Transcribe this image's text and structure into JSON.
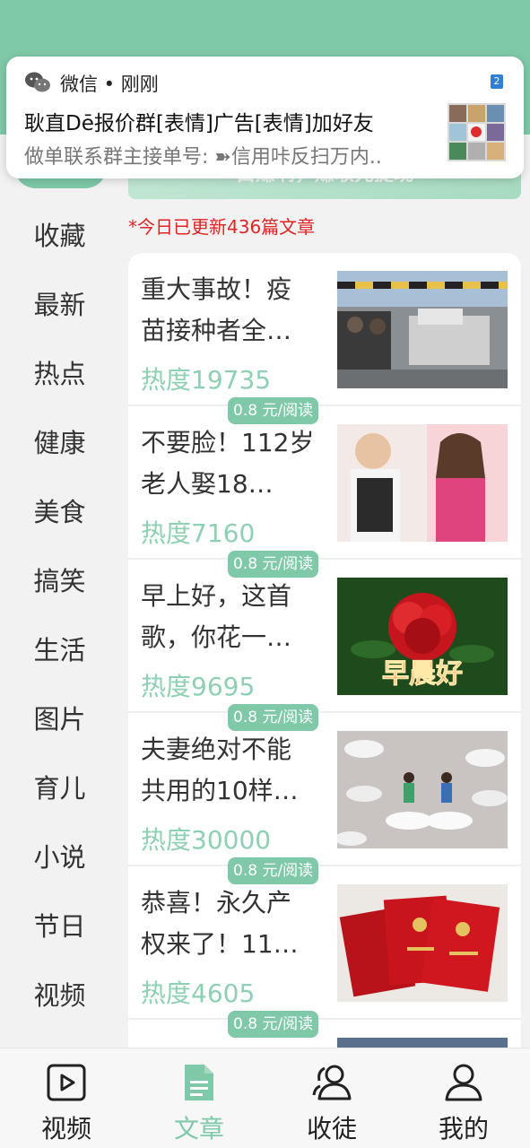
{
  "notification": {
    "app": "微信 • 刚刚",
    "badge": "2",
    "title": "耿直Dē报价群[表情]广告[表情]加好友",
    "body": "做单联系群主接单号: ➽信用咔反扫万内.."
  },
  "banner": {
    "text": "白赚啊，赚取先提现"
  },
  "update_notice": "*今日已更新436篇文章",
  "sidebar": {
    "items": [
      "收藏",
      "最新",
      "热点",
      "健康",
      "美食",
      "搞笑",
      "生活",
      "图片",
      "育儿",
      "小说",
      "节日",
      "视频"
    ]
  },
  "articles": [
    {
      "title": "重大事故！疫苗接种者全…",
      "heat": "热度19735",
      "price": "",
      "thumb": "accident-scene-photo"
    },
    {
      "title": "不要脸！112岁老人娶18…",
      "heat": "热度7160",
      "price": "0.8 元/阅读",
      "thumb": "elderly-couple-photo"
    },
    {
      "title": "早上好，这首歌，你花一…",
      "heat": "热度9695",
      "price": "0.8 元/阅读",
      "thumb": "red-rose-morning-photo",
      "thumb_text": "早晨好"
    },
    {
      "title": "夫妻绝对不能共用的10样…",
      "heat": "热度30000",
      "price": "0.8 元/阅读",
      "thumb": "pills-couple-photo"
    },
    {
      "title": "恭喜！永久产权来了！11…",
      "heat": "热度4605",
      "price": "0.8 元/阅读",
      "thumb": "property-certificates-photo"
    },
    {
      "title": "",
      "heat": "",
      "price": "0.8 元/阅读",
      "thumb": "partial-photo"
    }
  ],
  "bottom_nav": [
    {
      "label": "视频",
      "icon": "video-icon",
      "active": false
    },
    {
      "label": "文章",
      "icon": "article-icon",
      "active": true
    },
    {
      "label": "收徒",
      "icon": "apprentice-icon",
      "active": false
    },
    {
      "label": "我的",
      "icon": "profile-icon",
      "active": false
    }
  ],
  "colors": {
    "accent": "#7fc9a8",
    "heat": "#8ed0b3",
    "alert": "#e02424"
  }
}
